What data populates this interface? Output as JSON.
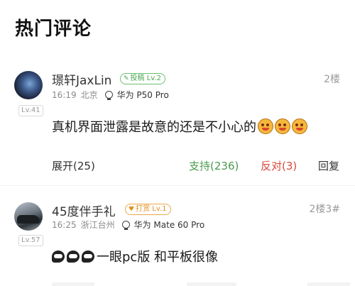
{
  "section_title": "热门评论",
  "comments": [
    {
      "username": "璟轩JaxLin",
      "badge": {
        "icon": "pencil-icon",
        "text": "投稿 Lv.2",
        "color": "#4aa851"
      },
      "level": "Lv.41",
      "time": "16:19",
      "location": "北京",
      "device": "华为 P50 Pro",
      "floor": "2楼",
      "text": "真机界面泄露是故意的还是不小心的",
      "emojis": [
        "grin-emoji",
        "grin-emoji",
        "grin-emoji"
      ],
      "actions": {
        "expand": "展开(25)",
        "support": "支持(236)",
        "oppose": "反对(3)",
        "reply": "回复"
      }
    },
    {
      "username": "45度伴手礼",
      "badge": {
        "icon": "heart-icon",
        "text": "打赏 Lv.1",
        "color": "#e38f1f"
      },
      "level": "Lv.57",
      "time": "16:25",
      "location": "浙江台州",
      "device": "华为 Mate 60 Pro",
      "floor": "2楼3#",
      "text": "一眼pc版 和平板很像",
      "emojis": [
        "speech-bubble-emoji",
        "speech-bubble-emoji",
        "speech-bubble-emoji"
      ]
    }
  ]
}
